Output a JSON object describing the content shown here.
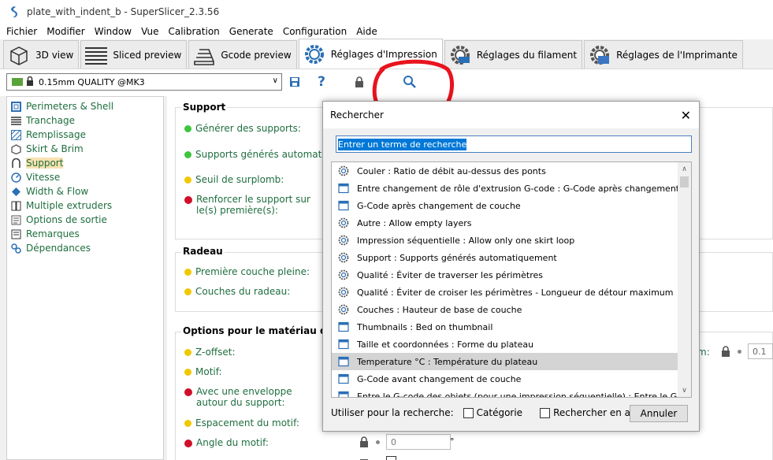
{
  "window": {
    "title": "plate_with_indent_b - SuperSlicer_2.3.56"
  },
  "menu": [
    "Fichier",
    "Modifier",
    "Window",
    "Vue",
    "Calibration",
    "Generate",
    "Configuration",
    "Aide"
  ],
  "tabs": [
    {
      "label": "3D view",
      "icon": "cube-icon"
    },
    {
      "label": "Sliced preview",
      "icon": "layers-icon"
    },
    {
      "label": "Gcode preview",
      "icon": "gcode-layers-icon"
    },
    {
      "label": "Réglages d'Impression",
      "icon": "gear-icon",
      "active": true
    },
    {
      "label": "Réglages du filament",
      "icon": "filament-gear-icon"
    },
    {
      "label": "Réglages de l'Imprimante",
      "icon": "printer-gear-icon"
    }
  ],
  "preset": {
    "selected": "0.15mm QUALITY @MK3"
  },
  "sidebar": {
    "items": [
      {
        "label": "Perimeters & Shell",
        "icon": "perimeter-icon"
      },
      {
        "label": "Tranchage",
        "icon": "slicing-icon"
      },
      {
        "label": "Remplissage",
        "icon": "infill-icon"
      },
      {
        "label": "Skirt & Brim",
        "icon": "skirt-icon"
      },
      {
        "label": "Support",
        "icon": "support-icon",
        "active": true
      },
      {
        "label": "Vitesse",
        "icon": "speed-icon"
      },
      {
        "label": "Width & Flow",
        "icon": "width-icon"
      },
      {
        "label": "Multiple extruders",
        "icon": "extruders-icon"
      },
      {
        "label": "Options de sortie",
        "icon": "output-icon"
      },
      {
        "label": "Remarques",
        "icon": "notes-icon"
      },
      {
        "label": "Dépendances",
        "icon": "dependencies-icon"
      }
    ]
  },
  "main": {
    "support": {
      "title": "Support",
      "options": [
        "Générer des supports:",
        "Supports générés automatique",
        "Seuil de surplomb:",
        "Renforcer le support sur le(s) première(s):"
      ]
    },
    "raft": {
      "title": "Radeau",
      "options": [
        "Première couche pleine:",
        "Couches du radeau:"
      ]
    },
    "material": {
      "title": "Options pour le matériau de supp",
      "options": [
        "Z-offset:",
        "Motif:",
        "Avec une enveloppe autour du support:",
        "Espacement du motif:",
        "Angle du motif:"
      ]
    },
    "right_value": "0.1",
    "right_label": "m:",
    "angle_value": "0",
    "angle_unit": "°"
  },
  "dialog": {
    "title": "Rechercher",
    "search_value": "Entrer un terme de recherche",
    "results": [
      {
        "text": "Couler : Ratio de débit au-dessus des ponts",
        "icon": "gear-icon"
      },
      {
        "text": "Entre changement de rôle d'extrusion G-code : G-Code après changement...",
        "icon": "window-icon"
      },
      {
        "text": "G-Code après changement de couche",
        "icon": "window-icon"
      },
      {
        "text": "Autre : Allow empty layers",
        "icon": "gear-icon"
      },
      {
        "text": "Impression séquentielle : Allow only one skirt loop",
        "icon": "gear-icon"
      },
      {
        "text": "Support : Supports générés automatiquement",
        "icon": "gear-icon"
      },
      {
        "text": "Qualité : Éviter de traverser les périmètres",
        "icon": "gear-icon"
      },
      {
        "text": "Qualité : Éviter de croiser les périmètres - Longueur de détour maximum",
        "icon": "gear-icon"
      },
      {
        "text": "Couches : Hauteur de base de couche",
        "icon": "gear-icon"
      },
      {
        "text": "Thumbnails : Bed on thumbnail",
        "icon": "window-icon"
      },
      {
        "text": "Taille et coordonnées : Forme du plateau",
        "icon": "window-icon"
      },
      {
        "text": "Temperature °C : Température du plateau",
        "icon": "window-icon",
        "selected": true
      },
      {
        "text": "G-Code avant changement de couche",
        "icon": "window-icon"
      },
      {
        "text": "Entre le G-code des objets (pour une impression séquentielle) : Entre le G-c",
        "icon": "window-icon"
      }
    ],
    "use_for_search_label": "Utiliser pour la recherche:",
    "category_label": "Catégorie",
    "english_label": "Rechercher en anglais",
    "cancel_label": "Annuler"
  },
  "colors": {
    "accent_green": "#1f6e3f",
    "selection_blue": "#0078d7",
    "annotation_red": "#e8141e"
  }
}
